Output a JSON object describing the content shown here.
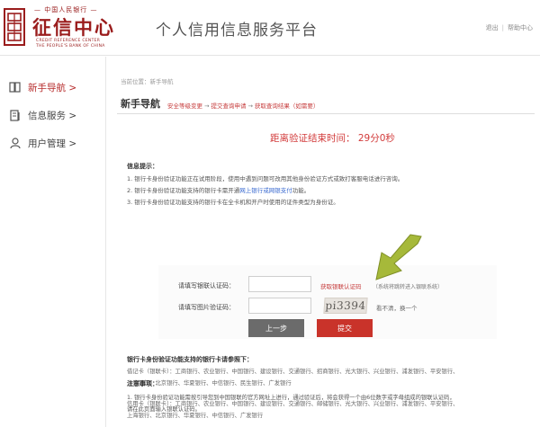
{
  "header": {
    "logo_top": "— 中国人民银行 —",
    "logo_main": "征信中心",
    "logo_en1": "CREDIT REFERENCE CENTER",
    "logo_en2": "THE PEOPLE'S BANK OF CHINA",
    "site_title": "个人信用信息服务平台",
    "link_exit": "退出",
    "link_help": "帮助中心"
  },
  "sidebar": {
    "items": [
      {
        "label": "新手导航 >",
        "icon": "book-icon",
        "active": true
      },
      {
        "label": "信息服务 >",
        "icon": "document-icon",
        "active": false
      },
      {
        "label": "用户管理 >",
        "icon": "user-icon",
        "active": false
      }
    ]
  },
  "main": {
    "breadcrumb": "当前位置：新手导航",
    "guide_title": "新手导航",
    "steps": [
      "安全等级变更",
      "提交查询申请",
      "获取查询结果（如需要）"
    ],
    "timer": "距离验证结束时间： 29分0秒",
    "info_title": "信息提示：",
    "info_lines": [
      "1. 银行卡身份验证功能正在试用阶段，使用中遇到问题可改用其他身份验证方式或致打客服电话进行咨询。",
      "2. 银行卡身份验证功能支持的银行卡需开通",
      "3. 银行卡身份验证功能支持的银行卡在全卡机和开户时使用的证件类型为身份证。"
    ],
    "info_link": "网上银行或网银支付",
    "info_link_suffix": "功能。",
    "form": {
      "code_label": "请填写银联认证码：",
      "code_value": "",
      "get_code": "获取银联认证码",
      "get_code_hint": "（系统将跳转进入银联系统）",
      "captcha_label": "请填写图片验证码：",
      "captcha_value": "",
      "captcha_text": "pi3394",
      "refresh": "看不清，换一个",
      "prev_button": "上一步",
      "submit_button": "提交"
    },
    "banks_title": "银行卡身份验证功能支持的银行卡请参照下：",
    "bank_lines": [
      "借记卡（银联卡）：工商银行、农业银行、中国银行、建设银行、交通银行、招商银行、光大银行、兴业银行、浦发银行、平安银行、",
      "上海银行、北京银行、华夏银行、中信银行、民生银行、广发银行",
      "信用卡（银联卡）：工商银行、农业银行、中国银行、建设银行、交通银行、邮储银行、光大银行、兴业银行、浦发银行、平安银行、",
      "上海银行、北京银行、华夏银行、中信银行、广发银行"
    ],
    "notes_title": "注意事项：",
    "note_lines": [
      "1. 银行卡身份验证功能需按引导您到中国银联的官方网址上进行，通过验证后，将会获得一个由6位数字或字母组成的银联认证码，",
      "请在此页面输入银联认证码。"
    ]
  },
  "colors": {
    "brand_red": "#9a1c1c",
    "accent_red": "#c9332a",
    "arrow_green": "#a6b93a"
  }
}
